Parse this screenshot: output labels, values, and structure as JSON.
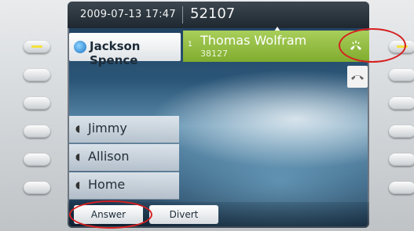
{
  "status": {
    "datetime": "2009-07-13 17:47",
    "extension": "52107"
  },
  "line1": {
    "label": "Jackson Spence"
  },
  "active_call": {
    "name": "Thomas Wolfram",
    "number": "38127",
    "channel": "1"
  },
  "speed_dials": [
    {
      "label": "Jimmy"
    },
    {
      "label": "Allison"
    },
    {
      "label": "Home"
    }
  ],
  "softkeys": {
    "answer": "Answer",
    "divert": "Divert"
  },
  "colors": {
    "call_accent": "#8dbb3c",
    "highlight_circle": "#d62020",
    "led": "#f3e23a"
  },
  "icons": {
    "line": "contact-bubble-icon",
    "ringing": "ringing-handset-icon",
    "hangup": "handset-icon",
    "speed_dial": "speaker-icon"
  }
}
